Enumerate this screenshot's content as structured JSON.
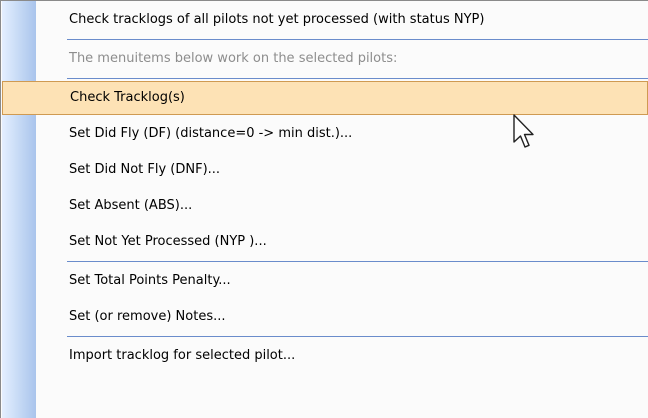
{
  "menu": {
    "items": [
      {
        "label": "Check tracklogs of all pilots not yet processed (with status NYP)"
      },
      {
        "label": "The menuitems below work on the selected pilots:"
      },
      {
        "label": "Check Tracklog(s)"
      },
      {
        "label": "Set Did Fly (DF) (distance=0 -> min dist.)..."
      },
      {
        "label": "Set Did Not Fly (DNF)..."
      },
      {
        "label": "Set Absent (ABS)..."
      },
      {
        "label": "Set Not Yet Processed (NYP )..."
      },
      {
        "label": "Set Total Points Penalty..."
      },
      {
        "label": "Set (or remove) Notes..."
      },
      {
        "label": "Import tracklog for selected pilot..."
      }
    ],
    "hovered_item": "Check Tracklog(s)",
    "colors": {
      "hover_fill": "#fde2b5",
      "hover_border": "#cf9a52",
      "separator": "#6a8ccb",
      "disabled_text": "#8d8d8d"
    }
  },
  "cursor": {
    "icon": "arrow-pointer-icon"
  }
}
